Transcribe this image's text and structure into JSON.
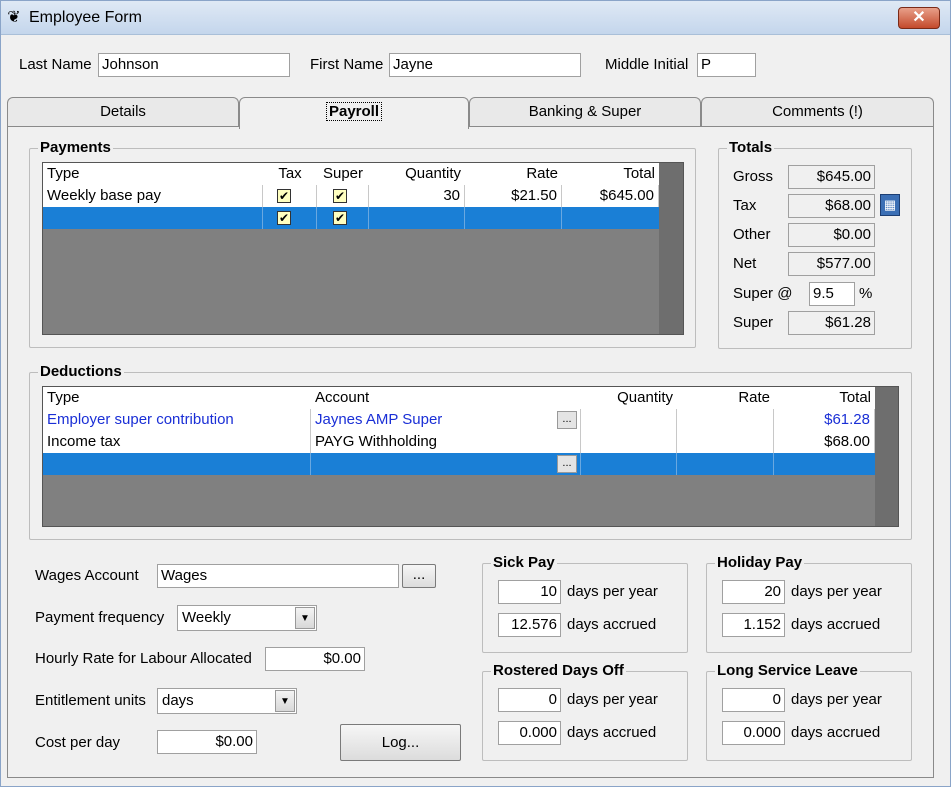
{
  "window": {
    "title": "Employee Form",
    "close_label": "✕"
  },
  "name_fields": {
    "last_name_label": "Last Name",
    "last_name": "Johnson",
    "first_name_label": "First Name",
    "first_name": "Jayne",
    "middle_initial_label": "Middle Initial",
    "middle_initial": "P"
  },
  "tabs": [
    "Details",
    "Payroll",
    "Banking & Super",
    "Comments (!)"
  ],
  "payments": {
    "title": "Payments",
    "headers": [
      "Type",
      "Tax",
      "Super",
      "Quantity",
      "Rate",
      "Total"
    ],
    "rows": [
      {
        "type": "Weekly base pay",
        "tax": true,
        "super": true,
        "quantity": "30",
        "rate": "$21.50",
        "total": "$645.00"
      }
    ]
  },
  "totals": {
    "title": "Totals",
    "gross_label": "Gross",
    "gross": "$645.00",
    "tax_label": "Tax",
    "tax": "$68.00",
    "other_label": "Other",
    "other": "$0.00",
    "net_label": "Net",
    "net": "$577.00",
    "super_rate_label": "Super @",
    "super_rate": "9.5",
    "percent": "%",
    "super_label": "Super",
    "super": "$61.28"
  },
  "deductions": {
    "title": "Deductions",
    "headers": [
      "Type",
      "Account",
      "Quantity",
      "Rate",
      "Total"
    ],
    "rows": [
      {
        "type": "Employer super contribution",
        "account": "Jaynes AMP Super",
        "quantity": "",
        "rate": "",
        "total": "$61.28"
      },
      {
        "type": "Income tax",
        "account": "PAYG Withholding",
        "quantity": "",
        "rate": "",
        "total": "$68.00"
      }
    ]
  },
  "wages": {
    "wages_account_label": "Wages Account",
    "wages_account": "Wages",
    "payment_frequency_label": "Payment frequency",
    "payment_frequency": "Weekly",
    "hourly_rate_label": "Hourly Rate for Labour Allocated",
    "hourly_rate": "$0.00",
    "entitlement_units_label": "Entitlement units",
    "entitlement_units": "days",
    "cost_per_day_label": "Cost per day",
    "cost_per_day": "$0.00",
    "log_button": "Log...",
    "ellipsis": "..."
  },
  "leave": {
    "per_year_label": "days per year",
    "accrued_label": "days accrued",
    "sick": {
      "title": "Sick Pay",
      "per_year": "10",
      "accrued": "12.576"
    },
    "holiday": {
      "title": "Holiday Pay",
      "per_year": "20",
      "accrued": "1.152"
    },
    "rdo": {
      "title": "Rostered Days Off",
      "per_year": "0",
      "accrued": "0.000"
    },
    "lsl": {
      "title": "Long Service Leave",
      "per_year": "0",
      "accrued": "0.000"
    }
  },
  "colors": {
    "selection": "#1a7fd6",
    "link_blue": "#1a2fd6",
    "grid_bg": "#808080"
  }
}
